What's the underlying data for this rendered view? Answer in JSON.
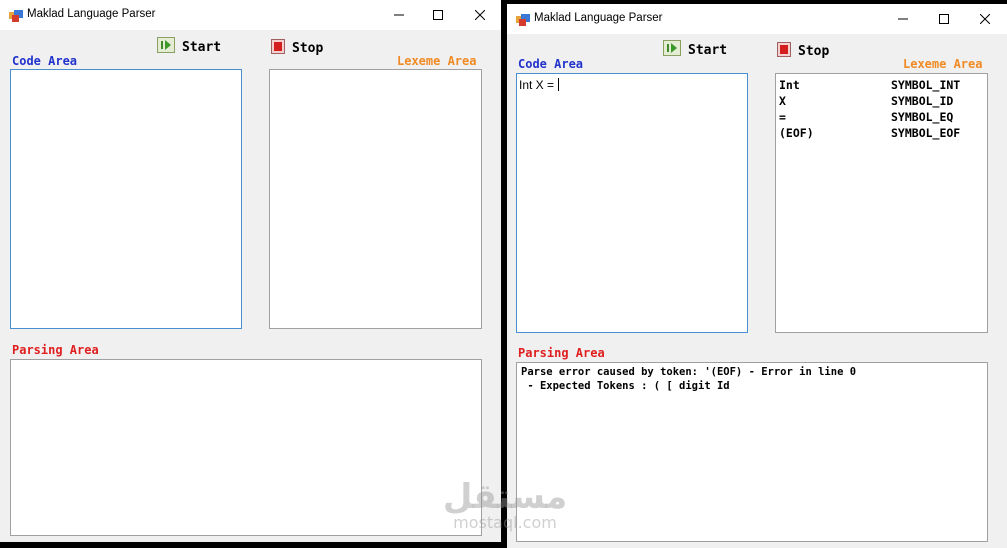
{
  "app": {
    "title": "Maklad Language Parser"
  },
  "toolbar": {
    "start_label": "Start",
    "stop_label": "Stop"
  },
  "labels": {
    "code": "Code Area",
    "lexeme": "Lexeme Area",
    "parsing": "Parsing Area"
  },
  "colors": {
    "code_label": "#2233cc",
    "lexeme_label": "#f08a24",
    "parsing_label": "#e02020",
    "focus_border": "#4a8fd0"
  },
  "icons": {
    "app": "app-window-icon",
    "start": "play-icon",
    "stop": "stop-icon",
    "minimize": "minimize-icon",
    "maximize": "maximize-icon",
    "close": "close-icon"
  },
  "right_window": {
    "code_text": "Int X = ",
    "lexemes": [
      {
        "lexeme": "Int",
        "token": "SYMBOL_INT"
      },
      {
        "lexeme": "X",
        "token": "SYMBOL_ID"
      },
      {
        "lexeme": "=",
        "token": "SYMBOL_EQ"
      },
      {
        "lexeme": "(EOF)",
        "token": "SYMBOL_EOF"
      }
    ],
    "parsing": [
      "Parse error caused by token: '(EOF) - Error in line 0",
      " - Expected Tokens : ( [ digit Id"
    ]
  },
  "watermark": {
    "arabic": "مستقل",
    "latin": "mostaql.com"
  }
}
